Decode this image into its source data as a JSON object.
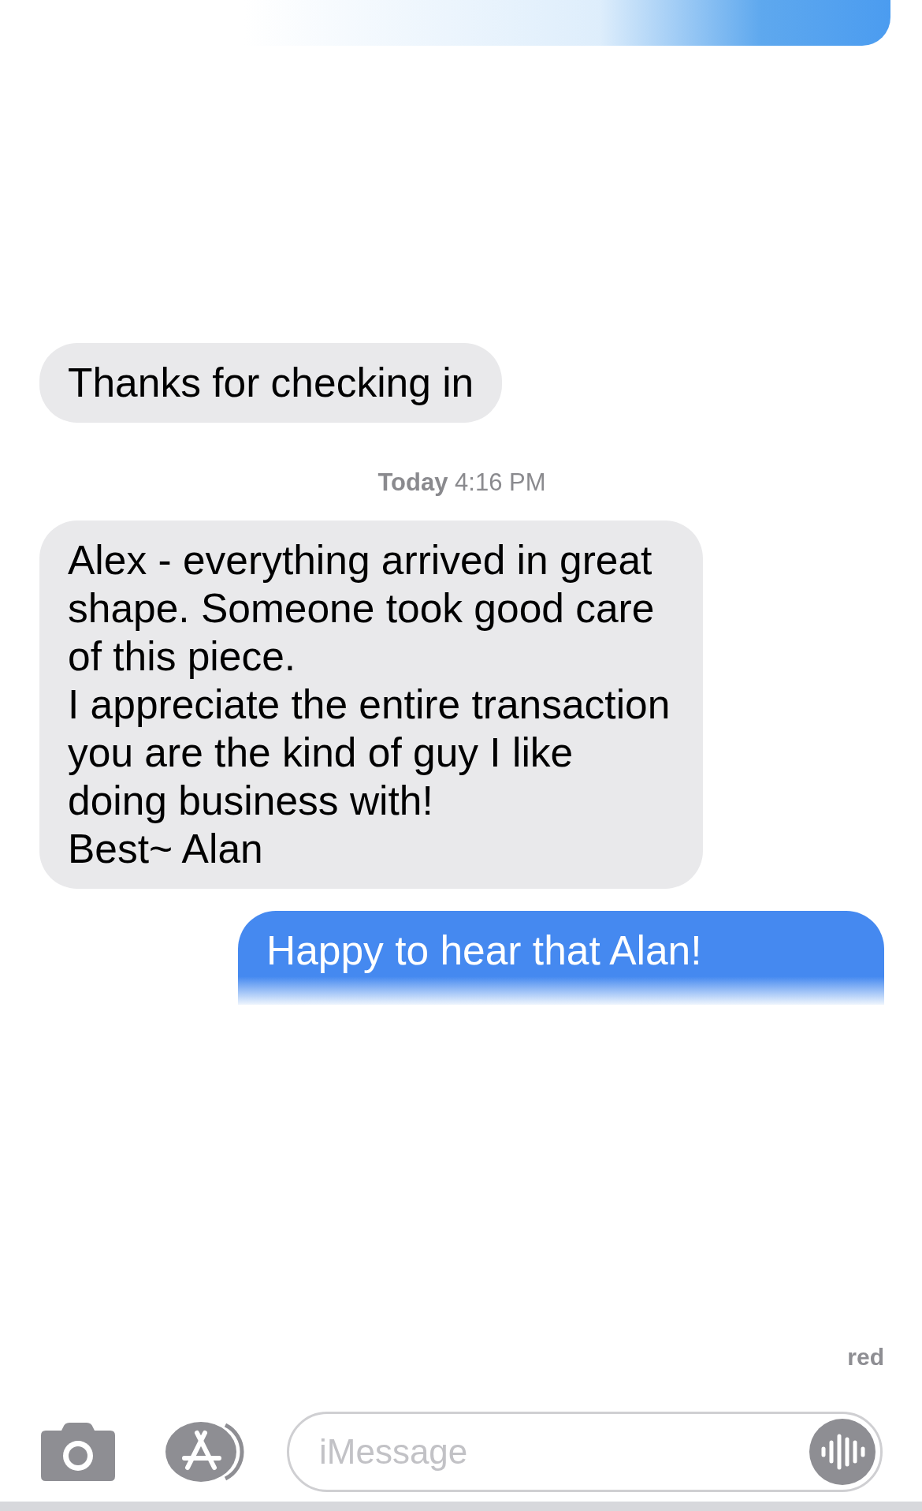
{
  "messages": [
    {
      "kind": "sent_fragment"
    },
    {
      "kind": "received",
      "text": "Thanks for checking in"
    },
    {
      "kind": "timestamp",
      "day": "Today",
      "time": "4:16 PM"
    },
    {
      "kind": "received",
      "text": "Alex - everything arrived in great shape. Someone took good care of this piece.\nI appreciate the entire transaction\nyou are the kind of guy I like doing business with!\nBest~ Alan"
    },
    {
      "kind": "sent",
      "text": "Happy to hear that Alan!"
    }
  ],
  "delivery_status": "red",
  "composer": {
    "placeholder": "iMessage"
  }
}
